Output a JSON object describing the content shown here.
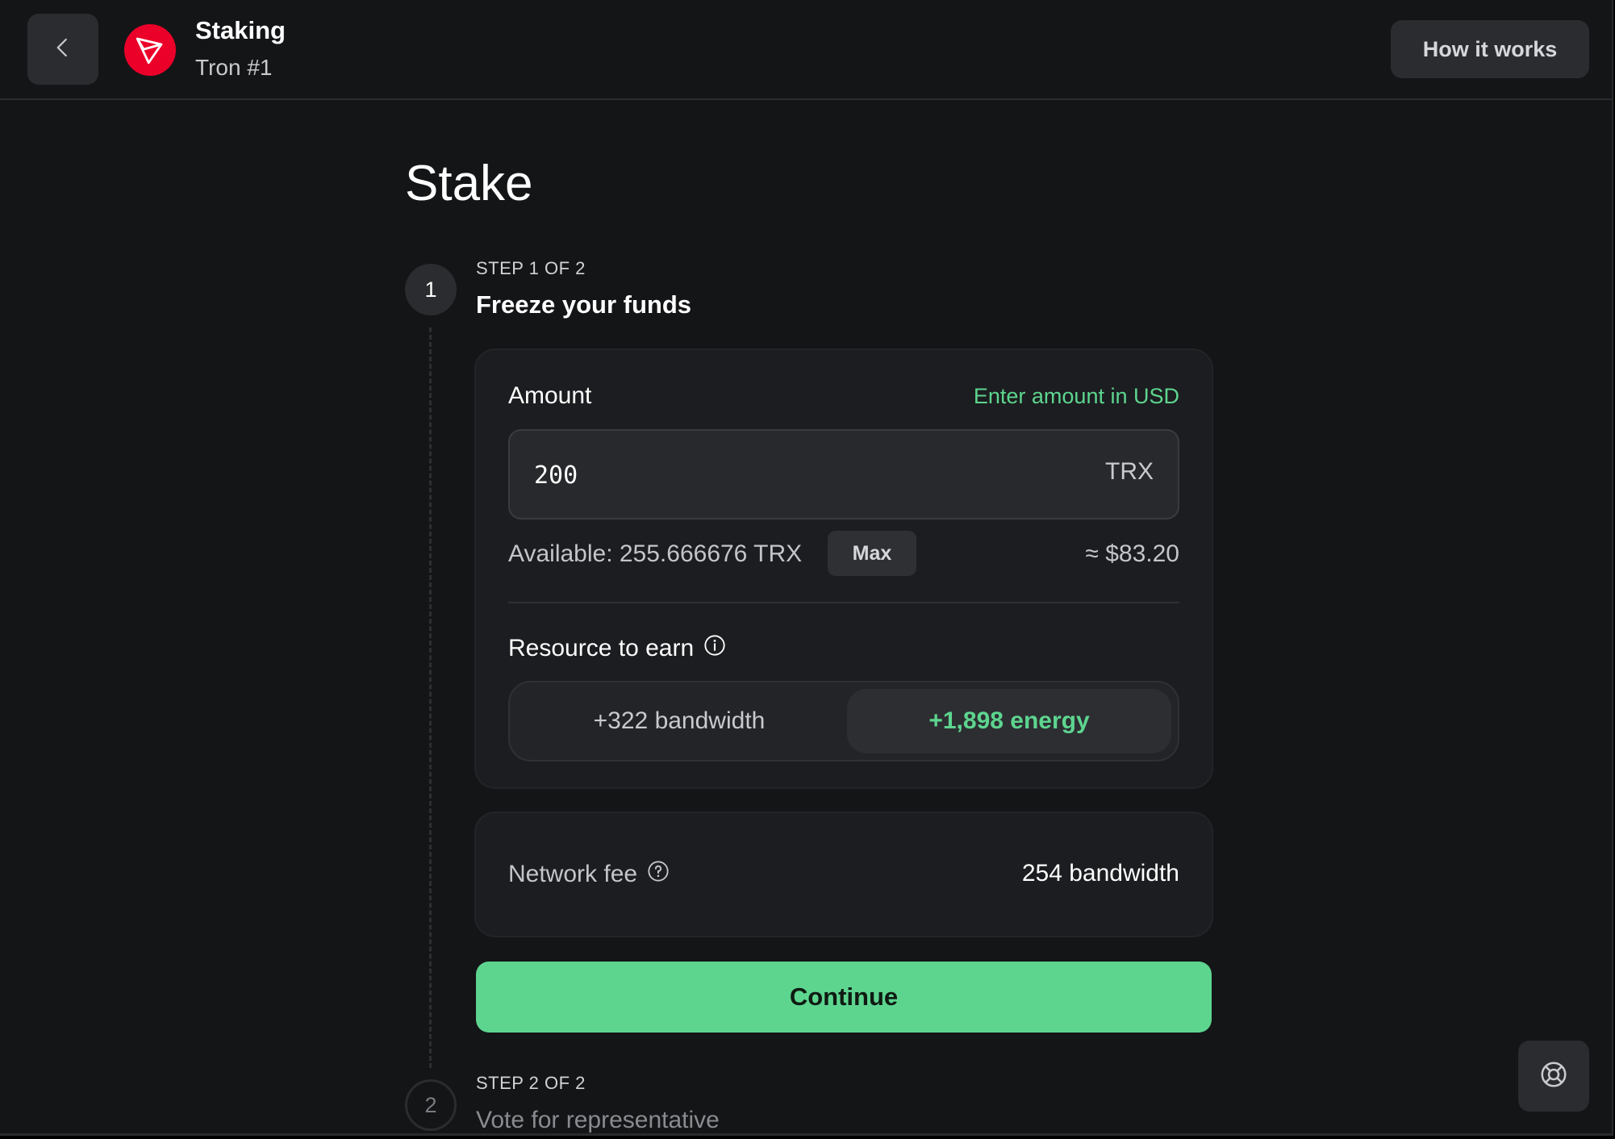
{
  "header": {
    "title": "Staking",
    "subtitle": "Tron #1",
    "how_label": "How it works",
    "back_icon": "chevron-left-icon",
    "logo_icon": "tron-logo-icon"
  },
  "page": {
    "title": "Stake"
  },
  "step1": {
    "number": "1",
    "label": "STEP 1 OF 2",
    "title": "Freeze your funds"
  },
  "amount": {
    "label": "Amount",
    "usd_link": "Enter amount in USD",
    "value": "200",
    "currency": "TRX",
    "available": "Available: 255.666676 TRX",
    "max_label": "Max",
    "usd_value": "≈ $83.20"
  },
  "resource": {
    "label": "Resource to earn",
    "options": [
      "+322 bandwidth",
      "+1,898 energy"
    ],
    "selected": "+1,898 energy"
  },
  "fee": {
    "label": "Network fee",
    "value": "254 bandwidth"
  },
  "continue_label": "Continue",
  "step2": {
    "number": "2",
    "label": "STEP 2 OF 2",
    "title": "Vote for representative"
  },
  "colors": {
    "accent": "#5dd58f",
    "background": "#141517",
    "card": "#1c1d20",
    "tron_red": "#eb0029"
  }
}
